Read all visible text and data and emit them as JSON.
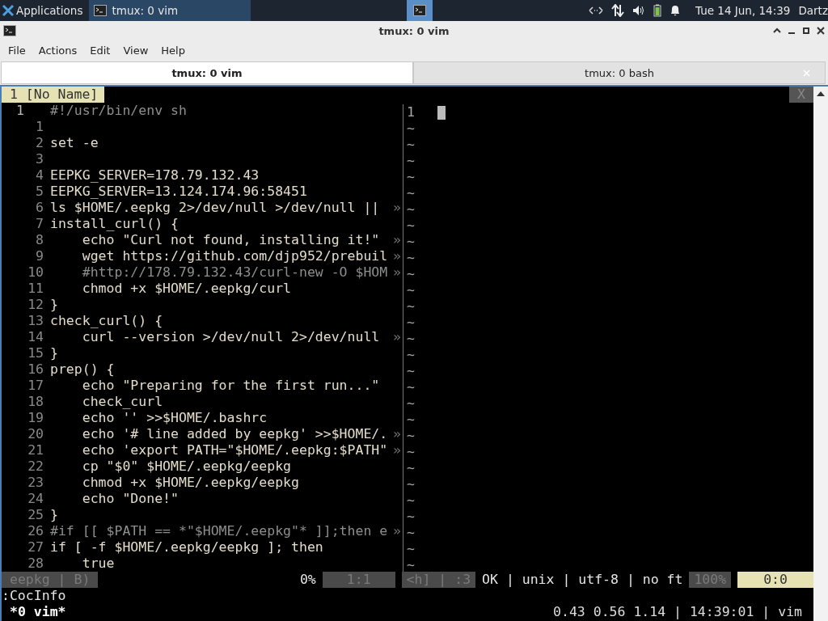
{
  "taskbar": {
    "app_menu": "Applications",
    "windows": [
      {
        "label": "tmux: 0 vim",
        "selected": true
      }
    ],
    "clock": "Tue 14 Jun, 14:39",
    "user": "Dartz"
  },
  "window": {
    "title": "tmux: 0 vim"
  },
  "menu": [
    "File",
    "Actions",
    "Edit",
    "View",
    "Help"
  ],
  "tabs": [
    {
      "label": "tmux: 0 vim",
      "selected": true
    },
    {
      "label": "tmux: 0 bash",
      "selected": false
    }
  ],
  "vim": {
    "buffer_tab": "1 [No Name]",
    "close_label": "X",
    "left_lines": [
      {
        "number": "1",
        "text": "#!/usr/bin/env sh",
        "kind": "comment",
        "current": true
      },
      {
        "number": "1",
        "current": false
      },
      {
        "number": "2",
        "text": "set -e",
        "kind": "code",
        "current": false
      },
      {
        "number": "3",
        "current": false
      },
      {
        "number": "4",
        "text": "EEPKG_SERVER=178.79.132.43",
        "kind": "code",
        "current": false
      },
      {
        "number": "5",
        "text": "EEPKG_SERVER=13.124.174.96:58451",
        "kind": "code",
        "current": false
      },
      {
        "number": "6",
        "text": "ls $HOME/.eepkg 2>/dev/null >/dev/null ||",
        "kind": "code",
        "current": false,
        "overflow_mark": "»"
      },
      {
        "number": "7",
        "text": "install_curl() {",
        "kind": "code",
        "current": false
      },
      {
        "number": "8",
        "text": "    echo \"Curl not found, installing it!\"",
        "kind": "code",
        "current": false,
        "overflow_mark": "»"
      },
      {
        "number": "9",
        "text": "    wget https://github.com/djp952/prebuil",
        "kind": "code",
        "current": false,
        "overflow_mark": "»"
      },
      {
        "number": "10",
        "text": "    #http://178.79.132.43/curl-new -O $HOM",
        "kind": "comment",
        "current": false,
        "overflow_mark": "»"
      },
      {
        "number": "11",
        "text": "    chmod +x $HOME/.eepkg/curl",
        "kind": "code",
        "current": false
      },
      {
        "number": "12",
        "text": "}",
        "kind": "code",
        "current": false
      },
      {
        "number": "13",
        "text": "check_curl() {",
        "kind": "code",
        "current": false
      },
      {
        "number": "14",
        "text": "    curl --version >/dev/null 2>/dev/null",
        "kind": "code",
        "current": false,
        "overflow_mark": "»"
      },
      {
        "number": "15",
        "text": "}",
        "kind": "code",
        "current": false
      },
      {
        "number": "16",
        "text": "prep() {",
        "kind": "code",
        "current": false
      },
      {
        "number": "17",
        "text": "    echo \"Preparing for the first run...\"",
        "kind": "code",
        "current": false
      },
      {
        "number": "18",
        "text": "    check_curl",
        "kind": "code",
        "current": false
      },
      {
        "number": "19",
        "text": "    echo '' >>$HOME/.bashrc",
        "kind": "code",
        "current": false
      },
      {
        "number": "20",
        "text": "    echo '# line added by eepkg' >>$HOME/.",
        "kind": "code",
        "current": false,
        "overflow_mark": "»"
      },
      {
        "number": "21",
        "text": "    echo 'export PATH=\"$HOME/.eepkg:$PATH\"",
        "kind": "code",
        "current": false,
        "overflow_mark": "»"
      },
      {
        "number": "22",
        "text": "    cp \"$0\" $HOME/.eepkg/eepkg",
        "kind": "code",
        "current": false
      },
      {
        "number": "23",
        "text": "    chmod +x $HOME/.eepkg/eepkg",
        "kind": "code",
        "current": false
      },
      {
        "number": "24",
        "text": "    echo \"Done!\"",
        "kind": "code",
        "current": false
      },
      {
        "number": "25",
        "text": "}",
        "kind": "code",
        "current": false
      },
      {
        "number": "26",
        "text": "#if [[ $PATH == *\"$HOME/.eepkg\"* ]];then e",
        "kind": "comment",
        "current": false,
        "overflow_mark": "»"
      },
      {
        "number": "27",
        "text": "if [ -f $HOME/.eepkg/eepkg ]; then",
        "kind": "code",
        "current": false
      },
      {
        "number": "28",
        "text": "    true",
        "kind": "code",
        "current": false
      }
    ],
    "right_lines": [
      "1",
      "~",
      "~",
      "~",
      "~",
      "~",
      "~",
      "~",
      "~",
      "~",
      "~",
      "~",
      "~",
      "~",
      "~",
      "~",
      "~",
      "~",
      "~",
      "~",
      "~",
      "~",
      "~",
      "~",
      "~",
      "~",
      "~",
      "~",
      "~"
    ],
    "statusline": [
      {
        "text": "eepkg | B)",
        "kind": "dim"
      },
      {
        "text": "0%",
        "kind": "plain"
      },
      {
        "text": "1:1",
        "kind": "dim"
      },
      {
        "text": "<h] | :3",
        "kind": "dim"
      },
      {
        "text": "OK | unix | utf-8 | no ft",
        "kind": "plain"
      },
      {
        "text": "100%",
        "kind": "dim"
      },
      {
        "text": "0:0",
        "kind": "accent"
      }
    ],
    "command": ":CocInfo"
  },
  "tmux": {
    "window": "*0 vim*",
    "status": "0.43 0.56 1.14 | 14:39:01 | vim"
  }
}
